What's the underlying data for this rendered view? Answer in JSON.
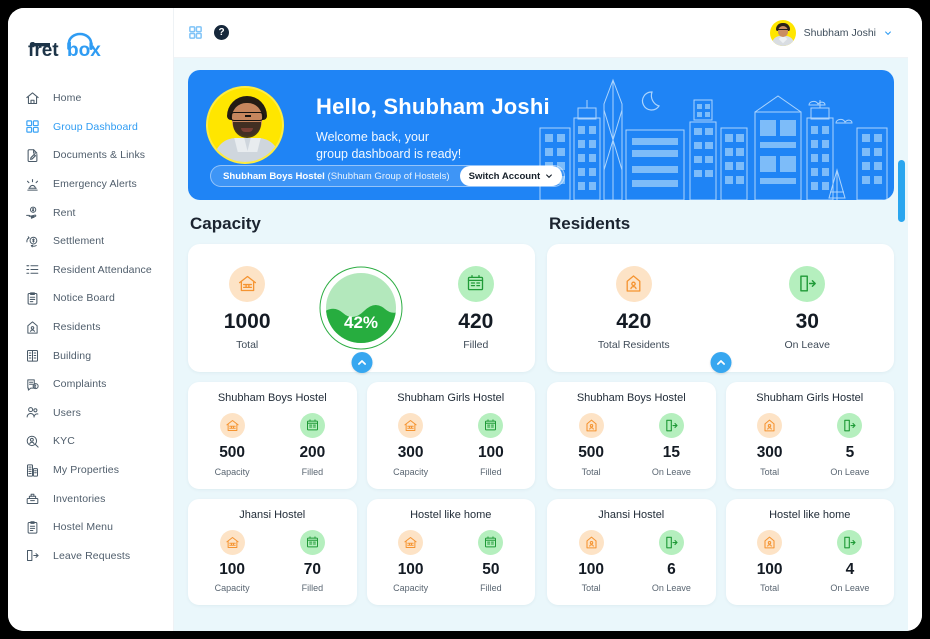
{
  "brand": {
    "name_dark": "fret",
    "name_blue": "box"
  },
  "sidebar": {
    "items": [
      {
        "label": "Home",
        "icon": "home-icon",
        "active": false
      },
      {
        "label": "Group Dashboard",
        "icon": "grid-icon",
        "active": true
      },
      {
        "label": "Documents & Links",
        "icon": "document-edit-icon",
        "active": false
      },
      {
        "label": "Emergency Alerts",
        "icon": "alarm-icon",
        "active": false
      },
      {
        "label": "Rent",
        "icon": "hand-money-icon",
        "active": false
      },
      {
        "label": "Settlement",
        "icon": "money-exchange-icon",
        "active": false
      },
      {
        "label": "Resident Attendance",
        "icon": "checklist-icon",
        "active": false
      },
      {
        "label": "Notice Board",
        "icon": "clipboard-icon",
        "active": false
      },
      {
        "label": "Residents",
        "icon": "person-house-icon",
        "active": false
      },
      {
        "label": "Building",
        "icon": "building-icon",
        "active": false
      },
      {
        "label": "Complaints",
        "icon": "complaint-icon",
        "active": false
      },
      {
        "label": "Users",
        "icon": "users-icon",
        "active": false
      },
      {
        "label": "KYC",
        "icon": "id-search-icon",
        "active": false
      },
      {
        "label": "My Properties",
        "icon": "properties-icon",
        "active": false
      },
      {
        "label": "Inventories",
        "icon": "inventory-icon",
        "active": false
      },
      {
        "label": "Hostel Menu",
        "icon": "menu-board-icon",
        "active": false
      },
      {
        "label": "Leave Requests",
        "icon": "exit-door-icon",
        "active": false
      }
    ]
  },
  "topbar": {
    "apps_icon": "apps-grid-icon",
    "help_icon": "help-circle-icon",
    "help_glyph": "?",
    "user_name": "Shubham Joshi",
    "chevron_icon": "chevron-down-icon"
  },
  "banner": {
    "greeting": "Hello, Shubham Joshi",
    "welcome_line": "Welcome back, your\ngroup dashboard is ready!",
    "account_name": "Shubham Boys Hostel",
    "account_group": "(Shubham Group of Hostels)",
    "switch_label": "Switch Account",
    "avatar_icon": "user-avatar-photo",
    "city_icon": "cityscape-illustration"
  },
  "capacity": {
    "title": "Capacity",
    "total_value": "1000",
    "total_label": "Total",
    "filled_value": "420",
    "filled_label": "Filled",
    "gauge_percent_text": "42%",
    "gauge_percent": 42,
    "total_icon": "capacity-house-icon",
    "filled_icon": "filled-building-icon",
    "collapse_icon": "chevron-up-icon",
    "hostels": [
      {
        "name": "Shubham Boys Hostel",
        "capacity": "500",
        "capacity_label": "Capacity",
        "filled": "200",
        "filled_label": "Filled"
      },
      {
        "name": "Shubham Girls Hostel",
        "capacity": "300",
        "capacity_label": "Capacity",
        "filled": "100",
        "filled_label": "Filled"
      },
      {
        "name": "Jhansi Hostel",
        "capacity": "100",
        "capacity_label": "Capacity",
        "filled": "70",
        "filled_label": "Filled"
      },
      {
        "name": "Hostel like home",
        "capacity": "100",
        "capacity_label": "Capacity",
        "filled": "50",
        "filled_label": "Filled"
      }
    ]
  },
  "residents": {
    "title": "Residents",
    "total_value": "420",
    "total_label": "Total Residents",
    "leave_value": "30",
    "leave_label": "On Leave",
    "total_icon": "resident-house-icon",
    "leave_icon": "exit-door-icon",
    "collapse_icon": "chevron-up-icon",
    "hostels": [
      {
        "name": "Shubham Boys Hostel",
        "total": "500",
        "total_label": "Total",
        "leave": "15",
        "leave_label": "On Leave"
      },
      {
        "name": "Shubham Girls Hostel",
        "total": "300",
        "total_label": "Total",
        "leave": "5",
        "leave_label": "On Leave"
      },
      {
        "name": "Jhansi Hostel",
        "total": "100",
        "total_label": "Total",
        "leave": "6",
        "leave_label": "On Leave"
      },
      {
        "name": "Hostel like home",
        "total": "100",
        "total_label": "Total",
        "leave": "4",
        "leave_label": "On Leave"
      }
    ]
  },
  "colors": {
    "accent_blue": "#1f84f5",
    "sidebar_active": "#2f9cf3",
    "page_bg": "#eaf7fb",
    "green": "#27ad3f",
    "orange_soft": "#fde3c6",
    "green_soft": "#b5efbe",
    "scrollbar": "#2aa6ef"
  },
  "chart_data": {
    "type": "bar",
    "title": "Capacity",
    "categories": [
      "Shubham Boys Hostel",
      "Shubham Girls Hostel",
      "Jhansi Hostel",
      "Hostel like home"
    ],
    "series": [
      {
        "name": "Capacity",
        "values": [
          500,
          300,
          100,
          100
        ]
      },
      {
        "name": "Filled",
        "values": [
          200,
          100,
          70,
          50
        ]
      }
    ],
    "totals": {
      "capacity_total": 1000,
      "filled_total": 420,
      "occupancy_percent": 42
    },
    "xlabel": "",
    "ylabel": "",
    "ylim": [
      0,
      500
    ]
  }
}
